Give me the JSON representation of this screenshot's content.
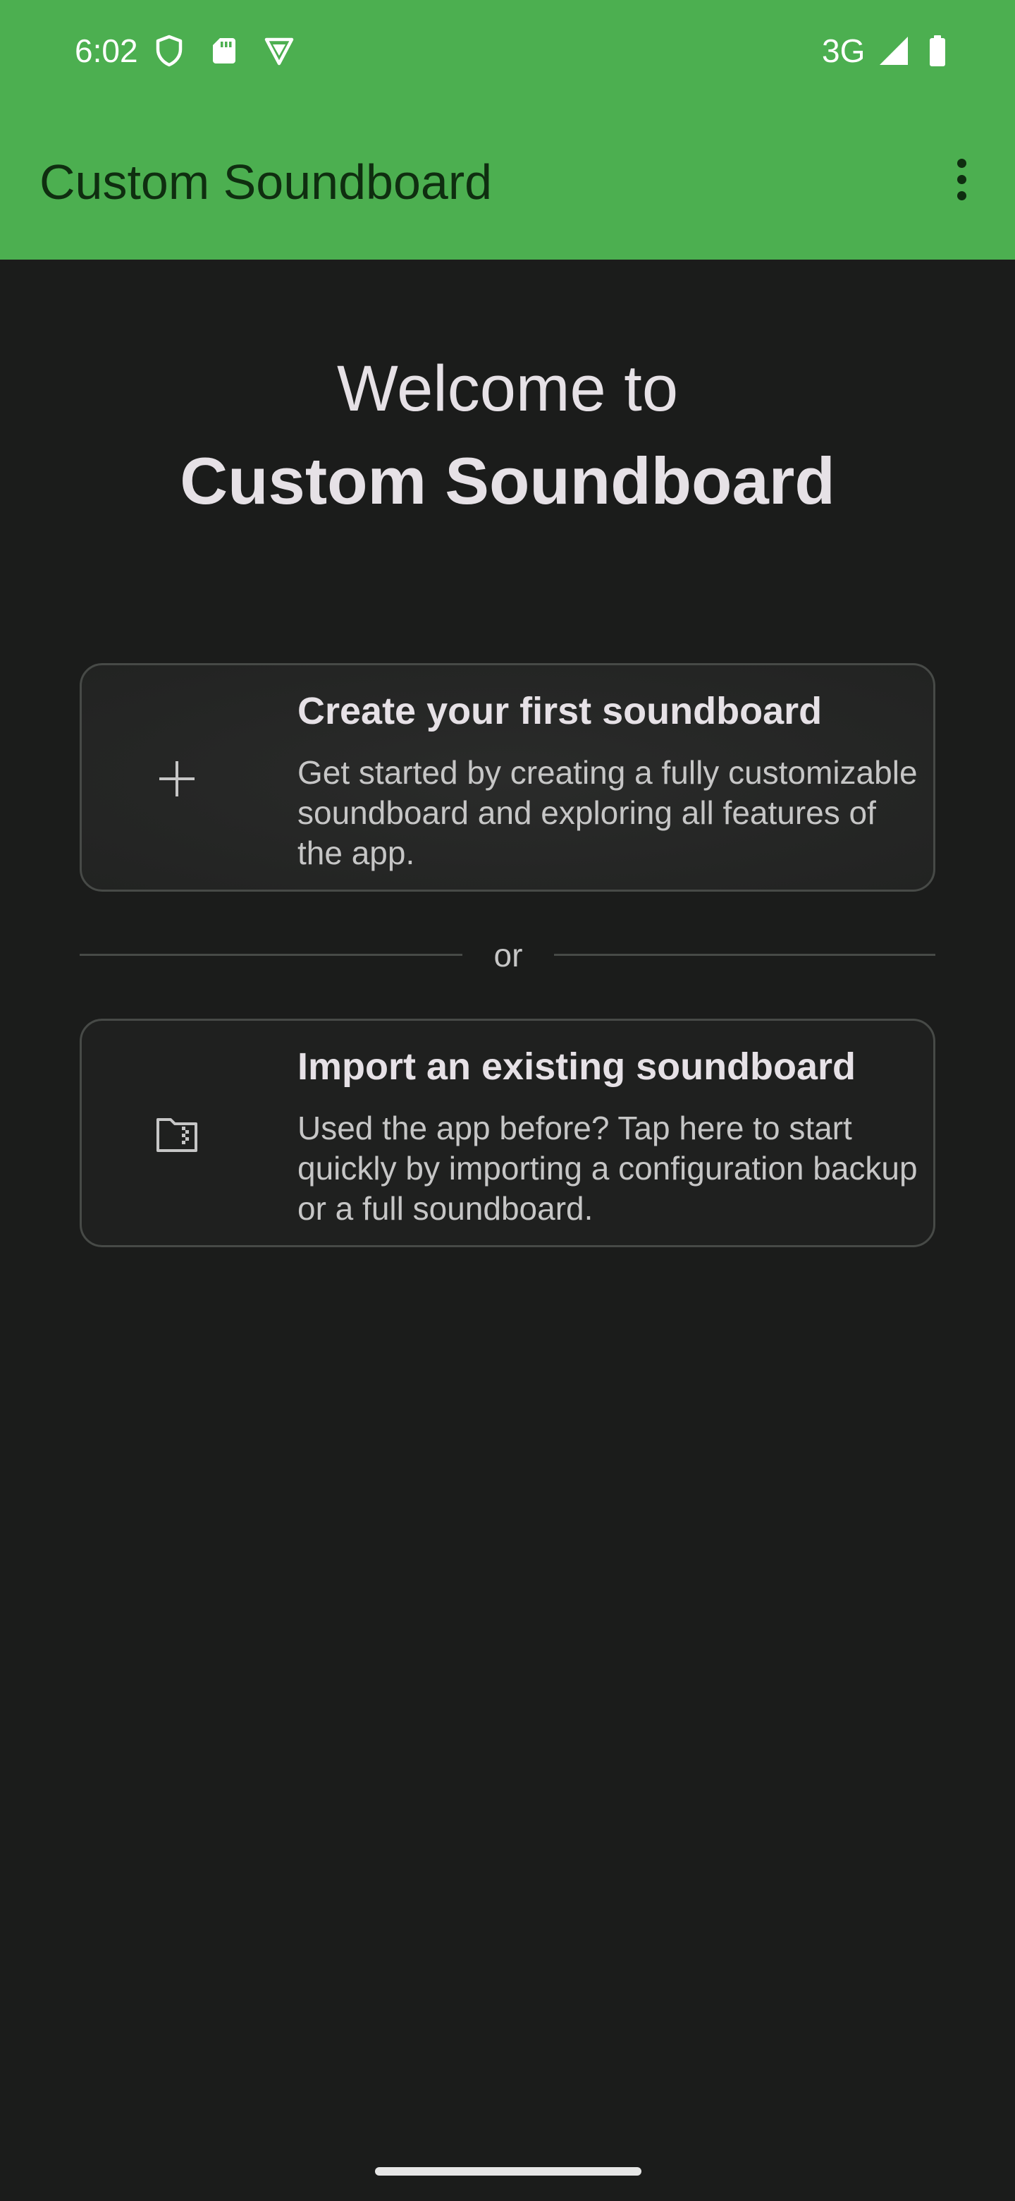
{
  "status_bar": {
    "time": "6:02",
    "network": "3G",
    "icons": [
      "shield-icon",
      "sd-card-icon",
      "vpn-icon",
      "signal-icon",
      "battery-icon"
    ]
  },
  "toolbar": {
    "title": "Custom Soundboard",
    "overflow_icon": "more-vert-icon"
  },
  "welcome": {
    "line1": "Welcome to",
    "line2": "Custom Soundboard"
  },
  "create_card": {
    "icon": "plus-icon",
    "title": "Create your first soundboard",
    "description": "Get started by creating a fully customizable soundboard and exploring all features of the app."
  },
  "divider": {
    "label": "or"
  },
  "import_card": {
    "icon": "folder-zip-icon",
    "title": "Import an existing soundboard",
    "description": "Used the app before? Tap here to start quickly by importing a configuration backup or a full soundboard."
  },
  "colors": {
    "header": "#4caf50",
    "background": "#1b1c1b",
    "title_text": "#0f2e10",
    "primary_text": "#e6e1e6",
    "secondary_text": "#c6c6c6",
    "card_border": "#474a47"
  }
}
